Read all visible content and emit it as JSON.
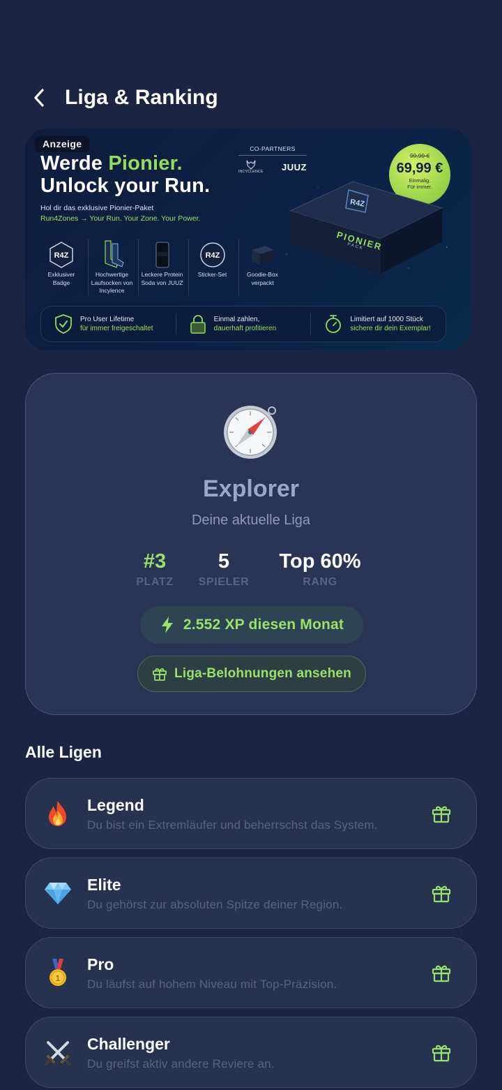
{
  "header": {
    "title": "Liga & Ranking"
  },
  "ad": {
    "tag": "Anzeige",
    "headline_part1": "Werde ",
    "headline_green": "Pionier.",
    "headline_line2": "Unlock your Run.",
    "sub1": "Hol dir das exklusive Pionier-Paket",
    "sub2": "Run4Zones → Your Run. Your Zone. Your Power.",
    "partners_title": "CO-PARTNERS",
    "partner1": "INCYCLENCE",
    "partner2": "JUUZ",
    "price_old": "99,99 €",
    "price_new": "69,99 €",
    "price_note1": "Einmalig.",
    "price_note2": "Für immer.",
    "box_logo": "R4Z",
    "box_title": "PIONIER",
    "box_sub": "PACK",
    "features": [
      {
        "label": "Exklusiver Badge"
      },
      {
        "label": "Hochwertige Laufsocken von Incylence"
      },
      {
        "label": "Leckere Protein Soda von JUUZ"
      },
      {
        "label": "Sticker-Set"
      },
      {
        "label": "Goodie-Box verpackt"
      }
    ],
    "benefits": [
      {
        "t1": "Pro User Lifetime",
        "t2": "für immer freigeschaltet"
      },
      {
        "t1": "Einmal zahlen,",
        "t2": "dauerhaft profitieren"
      },
      {
        "t1": "Limitiert auf 1000 Stück",
        "t2": "sichere dir dein Exemplar!"
      }
    ]
  },
  "league": {
    "name": "Explorer",
    "subtitle": "Deine aktuelle Liga",
    "stats": [
      {
        "value": "#3",
        "label": "PLATZ"
      },
      {
        "value": "5",
        "label": "SPIELER"
      },
      {
        "value": "Top 60%",
        "label": "RANG"
      }
    ],
    "xp": "2.552 XP diesen Monat",
    "rewards_button": "Liga-Belohnungen ansehen"
  },
  "all_leagues": {
    "title": "Alle Ligen",
    "items": [
      {
        "name": "Legend",
        "desc": "Du bist ein Extremläufer und beherrschst das System.",
        "icon": "fire-icon"
      },
      {
        "name": "Elite",
        "desc": "Du gehörst zur absoluten Spitze deiner Region.",
        "icon": "diamond-icon"
      },
      {
        "name": "Pro",
        "desc": "Du läufst auf hohem Niveau mit Top-Präzision.",
        "icon": "medal-icon"
      },
      {
        "name": "Challenger",
        "desc": "Du greifst aktiv andere Reviere an.",
        "icon": "crossed-swords-icon"
      }
    ]
  },
  "colors": {
    "background": "#1a2541",
    "accent_green": "#9ae06a",
    "card": "#283554"
  }
}
